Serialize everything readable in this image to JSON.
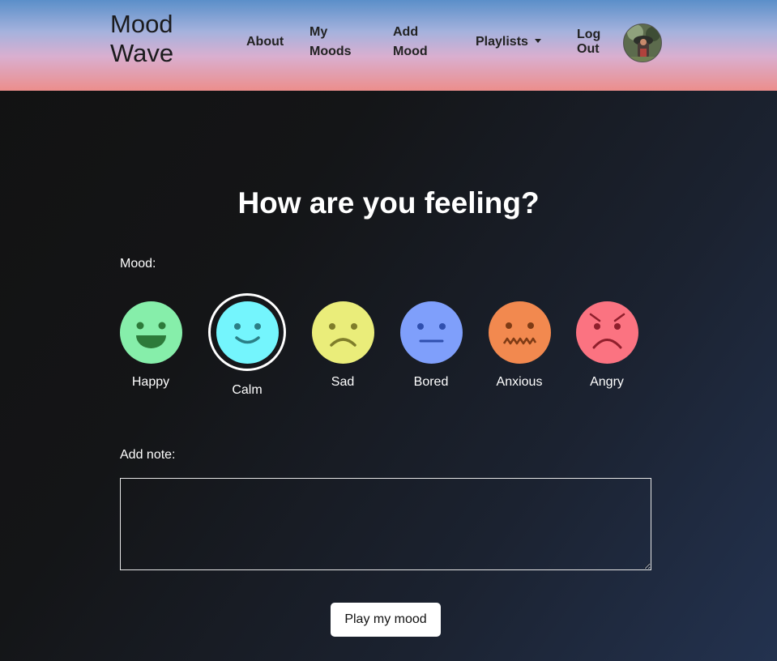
{
  "nav": {
    "brand": "Mood Wave",
    "about": "About",
    "my_moods": "My Moods",
    "add_mood": "Add Mood",
    "playlists": "Playlists",
    "log_out": "Log Out"
  },
  "main": {
    "heading": "How are you feeling?",
    "mood_label": "Mood:",
    "note_label": "Add note:",
    "note_value": "",
    "play_button": "Play my mood",
    "selected_mood": "Calm",
    "moods": [
      {
        "label": "Happy",
        "color": "#86eeaa",
        "icon": "happy-face-icon"
      },
      {
        "label": "Calm",
        "color": "#74f5fd",
        "icon": "calm-face-icon"
      },
      {
        "label": "Sad",
        "color": "#eaed7a",
        "icon": "sad-face-icon"
      },
      {
        "label": "Bored",
        "color": "#7f9ffb",
        "icon": "bored-face-icon"
      },
      {
        "label": "Anxious",
        "color": "#f2894f",
        "icon": "anxious-face-icon"
      },
      {
        "label": "Angry",
        "color": "#fb7381",
        "icon": "angry-face-icon"
      }
    ]
  }
}
